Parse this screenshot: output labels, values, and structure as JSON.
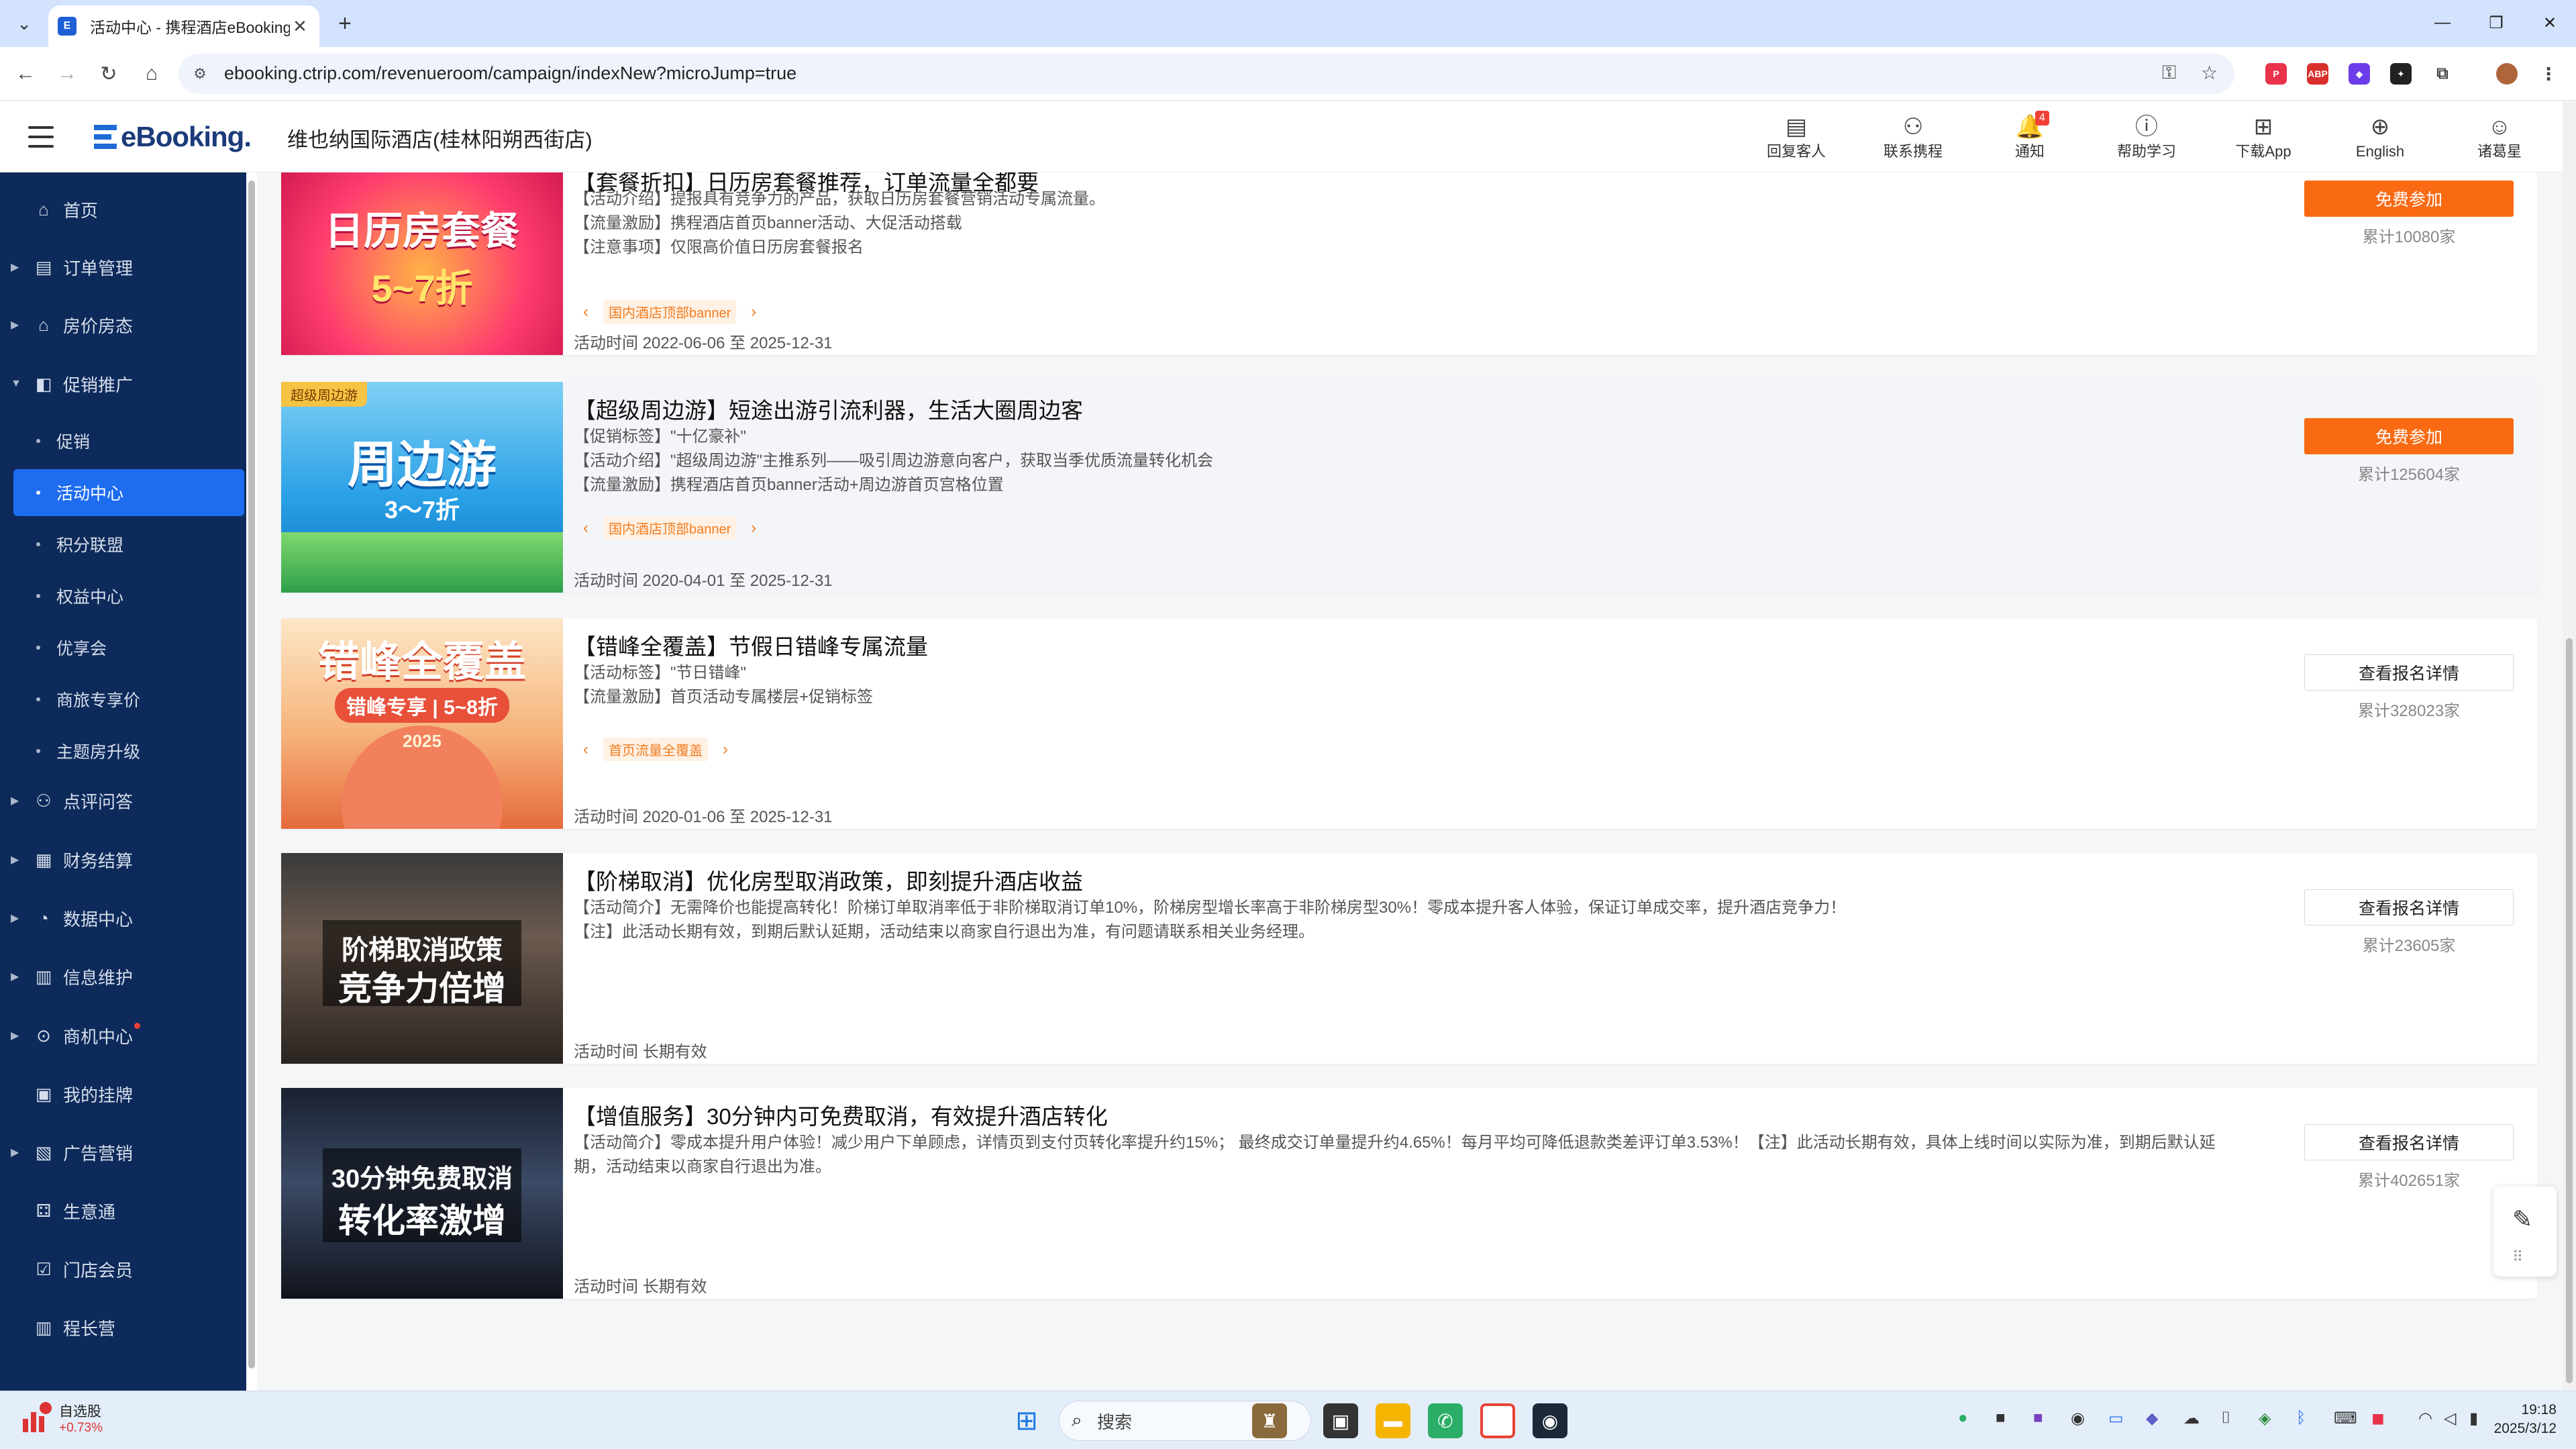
{
  "browser": {
    "tab_title": "活动中心 - 携程酒店eBooking",
    "url": "ebooking.ctrip.com/revenueroom/campaign/indexNew?microJump=true"
  },
  "header": {
    "logo": "eBooking.",
    "hotel_name": "维也纳国际酒店(桂林阳朔西街店)",
    "actions": [
      {
        "label": "回复客人",
        "icon": "message-reply-icon"
      },
      {
        "label": "联系携程",
        "icon": "contact-person-icon"
      },
      {
        "label": "通知",
        "icon": "bell-icon",
        "badge": "4"
      },
      {
        "label": "帮助学习",
        "icon": "help-icon"
      },
      {
        "label": "下载App",
        "icon": "app-grid-icon"
      },
      {
        "label": "English",
        "icon": "globe-icon"
      },
      {
        "label": "诸葛星",
        "icon": "user-icon"
      }
    ]
  },
  "sidebar": {
    "items": [
      {
        "label": "首页",
        "icon": "home-icon",
        "expandable": false
      },
      {
        "label": "订单管理",
        "icon": "order-icon",
        "expandable": true
      },
      {
        "label": "房价房态",
        "icon": "house-icon",
        "expandable": true
      },
      {
        "label": "促销推广",
        "icon": "promo-icon",
        "expandable": true,
        "expanded": true
      },
      {
        "label": "促销",
        "sub": true
      },
      {
        "label": "活动中心",
        "sub": true,
        "active": true
      },
      {
        "label": "积分联盟",
        "sub": true
      },
      {
        "label": "权益中心",
        "sub": true
      },
      {
        "label": "优享会",
        "sub": true
      },
      {
        "label": "商旅专享价",
        "sub": true
      },
      {
        "label": "主题房升级",
        "sub": true
      },
      {
        "label": "点评问答",
        "icon": "review-icon",
        "expandable": true
      },
      {
        "label": "财务结算",
        "icon": "finance-icon",
        "expandable": true
      },
      {
        "label": "数据中心",
        "icon": "data-icon",
        "expandable": true
      },
      {
        "label": "信息维护",
        "icon": "info-icon",
        "expandable": true
      },
      {
        "label": "商机中心",
        "icon": "opportunity-icon",
        "expandable": true,
        "dot": true
      },
      {
        "label": "我的挂牌",
        "icon": "badge-icon",
        "expandable": false
      },
      {
        "label": "广告营销",
        "icon": "ad-icon",
        "expandable": true
      },
      {
        "label": "生意通",
        "icon": "business-icon",
        "expandable": false
      },
      {
        "label": "门店会员",
        "icon": "member-icon",
        "expandable": false
      },
      {
        "label": "程长营",
        "icon": "camp-icon",
        "expandable": false
      }
    ]
  },
  "campaigns": [
    {
      "title": "【套餐折扣】日历房套餐推荐，订单流量全都要",
      "desc": [
        "【活动介绍】提报具有竞争力的产品，获取日历房套餐营销活动专属流量。",
        "【流量激励】携程酒店首页banner活动、大促活动搭载",
        "【注意事项】仅限高价值日历房套餐报名"
      ],
      "tag": "国内酒店顶部banner",
      "time": "活动时间 2022-06-06 至 2025-12-31",
      "button": "免费参加",
      "count": "累计10080家",
      "image_text": [
        "日历房套餐",
        "5~7折"
      ],
      "image_badge": ""
    },
    {
      "title": "【超级周边游】短途出游引流利器，生活大圈周边客",
      "desc": [
        "【促销标签】\"十亿豪补\"",
        "【活动介绍】\"超级周边游\"主推系列——吸引周边游意向客户，获取当季优质流量转化机会",
        "【流量激励】携程酒店首页banner活动+周边游首页宫格位置"
      ],
      "tag": "国内酒店顶部banner",
      "time": "活动时间 2020-04-01 至 2025-12-31",
      "button": "免费参加",
      "count": "累计125604家",
      "image_text": [
        "周边游",
        "3～7折"
      ],
      "image_badge": "超级周边游"
    },
    {
      "title": "【错峰全覆盖】节假日错峰专属流量",
      "desc": [
        "【活动标签】\"节日错峰\"",
        "【流量激励】首页活动专属楼层+促销标签"
      ],
      "tag": "首页流量全覆盖",
      "time": "活动时间 2020-01-06 至 2025-12-31",
      "button": "查看报名详情",
      "count": "累计328023家",
      "image_text": [
        "错峰全覆盖",
        "错峰专享 | 5~8折",
        "2025"
      ],
      "image_badge": ""
    },
    {
      "title": "【阶梯取消】优化房型取消政策，即刻提升酒店收益",
      "desc": [
        "【活动简介】无需降价也能提高转化！阶梯订单取消率低于非阶梯取消订单10%，阶梯房型增长率高于非阶梯房型30%！零成本提升客人体验，保证订单成交率，提升酒店竞争力！",
        "【注】此活动长期有效，到期后默认延期，活动结束以商家自行退出为准，有问题请联系相关业务经理。"
      ],
      "tag": "",
      "time": "活动时间 长期有效",
      "button": "查看报名详情",
      "count": "累计23605家",
      "image_text": [
        "阶梯取消政策",
        "竞争力倍增"
      ],
      "image_badge": ""
    },
    {
      "title": "【增值服务】30分钟内可免费取消，有效提升酒店转化",
      "desc": [
        "【活动简介】零成本提升用户体验！减少用户下单顾虑，详情页到支付页转化率提升约15%； 最终成交订单量提升约4.65%！每月平均可降低退款类差评订单3.53%！【注】此活动长期有效，具体上线时间以实际为准，到期后默认延",
        "期，活动结束以商家自行退出为准。"
      ],
      "tag": "",
      "time": "活动时间 长期有效",
      "button": "查看报名详情",
      "count": "累计402651家",
      "image_text": [
        "30分钟免费取消",
        "转化率激增"
      ],
      "image_badge": ""
    }
  ],
  "taskbar": {
    "stock_name": "自选股",
    "stock_change": "+0.73%",
    "search_placeholder": "搜索",
    "time": "19:18",
    "date": "2025/3/12"
  },
  "colors": {
    "sidebar_bg": "#0d2a5a",
    "active_blue": "#1e6cf0",
    "accent_orange": "#fa6a13"
  }
}
